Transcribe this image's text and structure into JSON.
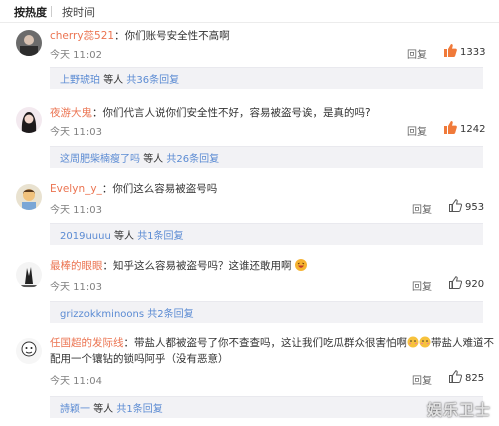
{
  "tabs": {
    "hot": "按热度",
    "time": "按时间"
  },
  "comments": [
    {
      "user": "cherry蕊521",
      "text": "你们账号安全性不高啊",
      "time": "今天 11:02",
      "reply_label": "回复",
      "likes": "1333",
      "liked": true,
      "sub": {
        "user": "上野琥珀",
        "middle": "等人",
        "count": "共36条回复"
      }
    },
    {
      "user": "夜游大鬼",
      "text": "你们代言人说你们安全性不好，容易被盗号诶，是真的吗?",
      "time": "今天 11:03",
      "reply_label": "回复",
      "likes": "1242",
      "liked": true,
      "sub": {
        "user": "这周肥柴楠瘦了吗",
        "middle": "等人",
        "count": "共26条回复"
      }
    },
    {
      "user": "Evelyn_y_",
      "text": "你们这么容易被盗号吗",
      "time": "今天 11:03",
      "reply_label": "回复",
      "likes": "953",
      "liked": false,
      "sub": {
        "user": "2019uuuu",
        "middle": "等人",
        "count": "共1条回复"
      }
    },
    {
      "user": "最棒的眼眼",
      "text": "知乎这么容易被盗号吗？这谁还敢用啊",
      "time": "今天 11:03",
      "reply_label": "回复",
      "likes": "920",
      "liked": false,
      "sub": {
        "user": "grizzokkminoons",
        "middle": "",
        "count": "共2条回复"
      }
    },
    {
      "user": "任国超的发际线",
      "text1": "带盐人都被盗号了你不查查吗，这让我们吃瓜群众很害怕啊",
      "text1b": "带盐人难道不",
      "text2": "配用一个镶钻的锁吗阿乎（没有恶意）",
      "time": "今天 11:04",
      "reply_label": "回复",
      "likes": "825",
      "liked": false,
      "sub": {
        "user": "詩颖一",
        "middle": "等人",
        "count": "共1条回复"
      }
    }
  ],
  "watermark": "娱乐卫士",
  "colors": {
    "username": "#eb7350",
    "link": "#5b8bd3",
    "liked": "#f07a3a",
    "unliked": "#555555"
  }
}
